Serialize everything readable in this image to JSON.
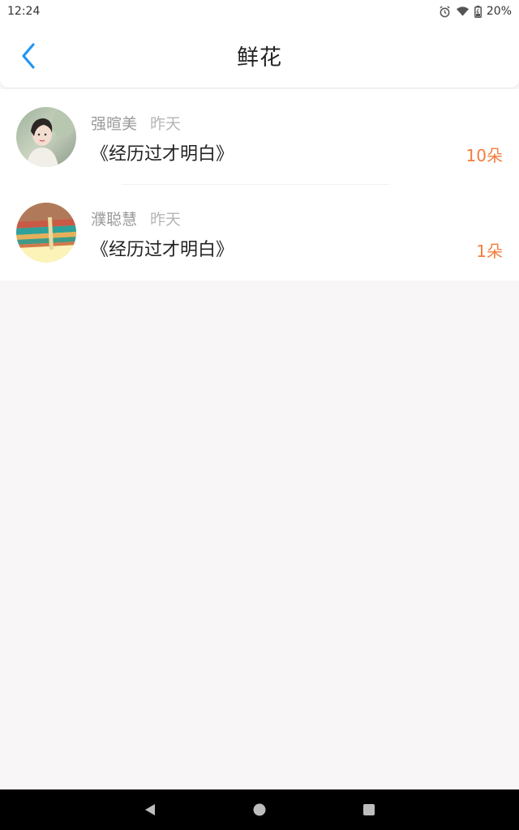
{
  "status_bar": {
    "time": "12:24",
    "battery_text": "20%",
    "icons": [
      "alarm-icon",
      "wifi-icon",
      "battery-icon"
    ]
  },
  "header": {
    "title": "鲜花",
    "back_icon": "chevron-left-icon"
  },
  "list": {
    "items": [
      {
        "name": "强暄美",
        "time": "昨天",
        "book": "《经历过才明白》",
        "count": "10朵"
      },
      {
        "name": "濮聪慧",
        "time": "昨天",
        "book": "《经历过才明白》",
        "count": "1朵"
      }
    ]
  },
  "nav": {
    "icons": [
      "back-triangle-icon",
      "home-circle-icon",
      "recents-square-icon"
    ]
  },
  "colors": {
    "accent": "#2196f3",
    "count": "#f47c3c",
    "name": "#9a9a9a",
    "background": "#f8f6f6"
  }
}
